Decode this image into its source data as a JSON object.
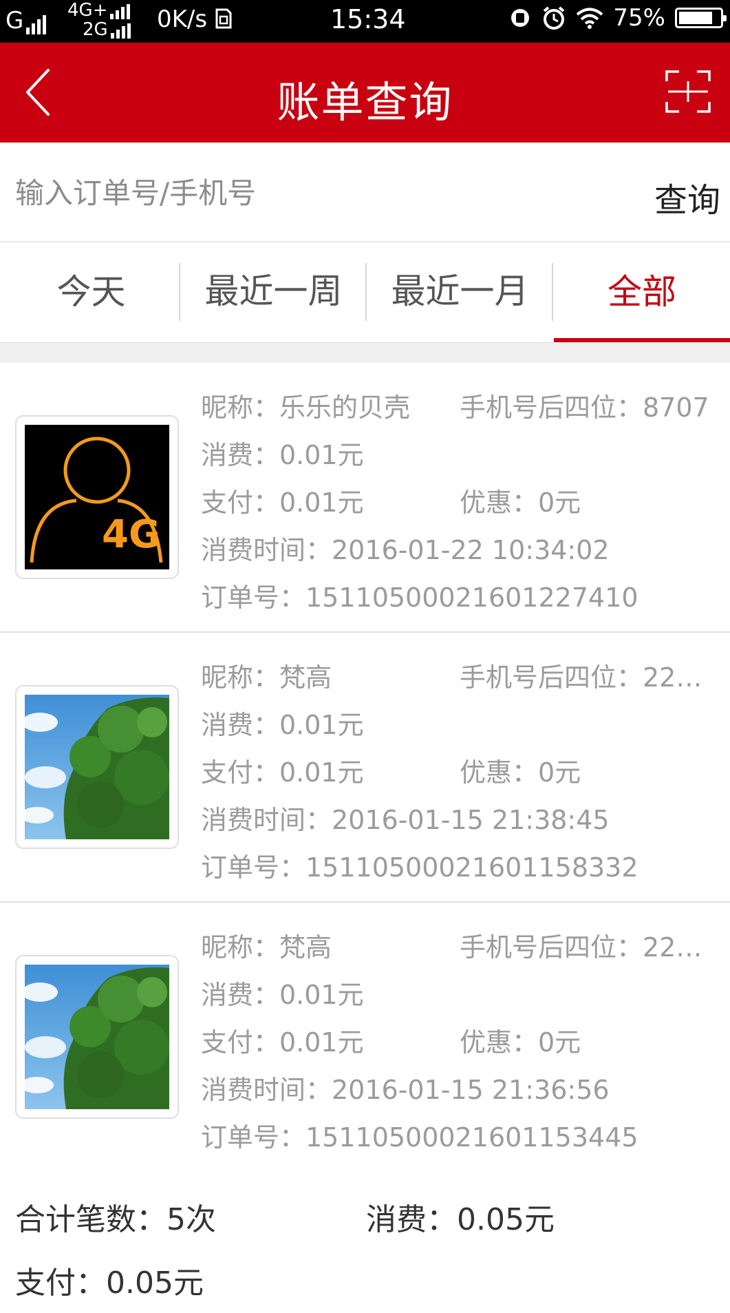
{
  "status_bar": {
    "signal1": "G",
    "network_top": "4G+",
    "network_bottom": "2G",
    "speed": "0K/s",
    "time": "15:34",
    "battery": "75%",
    "battery_level": 0.75
  },
  "header": {
    "title": "账单查询",
    "back_icon": "chevron-left-icon",
    "scan_icon": "scan-icon"
  },
  "search": {
    "placeholder": "输入订单号/手机号",
    "value": "",
    "button": "查询"
  },
  "tabs": [
    {
      "label": "今天",
      "active": false
    },
    {
      "label": "最近一周",
      "active": false
    },
    {
      "label": "最近一月",
      "active": false
    },
    {
      "label": "全部",
      "active": true
    }
  ],
  "bills": [
    {
      "avatar": "4g-user-avatar",
      "nickname": "昵称：乐乐的贝壳",
      "phone_tail": "手机号后四位：8707",
      "consume": "消费：0.01元",
      "pay": "支付：0.01元",
      "discount": "优惠：0元",
      "time": "消费时间：2016-01-22 10:34:02",
      "order": "订单号：151105000216012274​10"
    },
    {
      "avatar": "tree-avatar",
      "nickname": "昵称：梵高",
      "phone_tail": "手机号后四位：22…",
      "consume": "消费：0.01元",
      "pay": "支付：0.01元",
      "discount": "优惠：0元",
      "time": "消费时间：2016-01-15 21:38:45",
      "order": "订单号：151105000216011583​32"
    },
    {
      "avatar": "tree-avatar",
      "nickname": "昵称：梵高",
      "phone_tail": "手机号后四位：22…",
      "consume": "消费：0.01元",
      "pay": "支付：0.01元",
      "discount": "优惠：0元",
      "time": "消费时间：2016-01-15 21:36:56",
      "order": "订单号：151105000216011534​45"
    }
  ],
  "summary": {
    "count": "合计笔数：5次",
    "consume": "消费：0.05元",
    "pay": "支付：0.05元"
  },
  "colors": {
    "brand_red": "#c8000f",
    "text_gray": "#9b9b9b"
  }
}
